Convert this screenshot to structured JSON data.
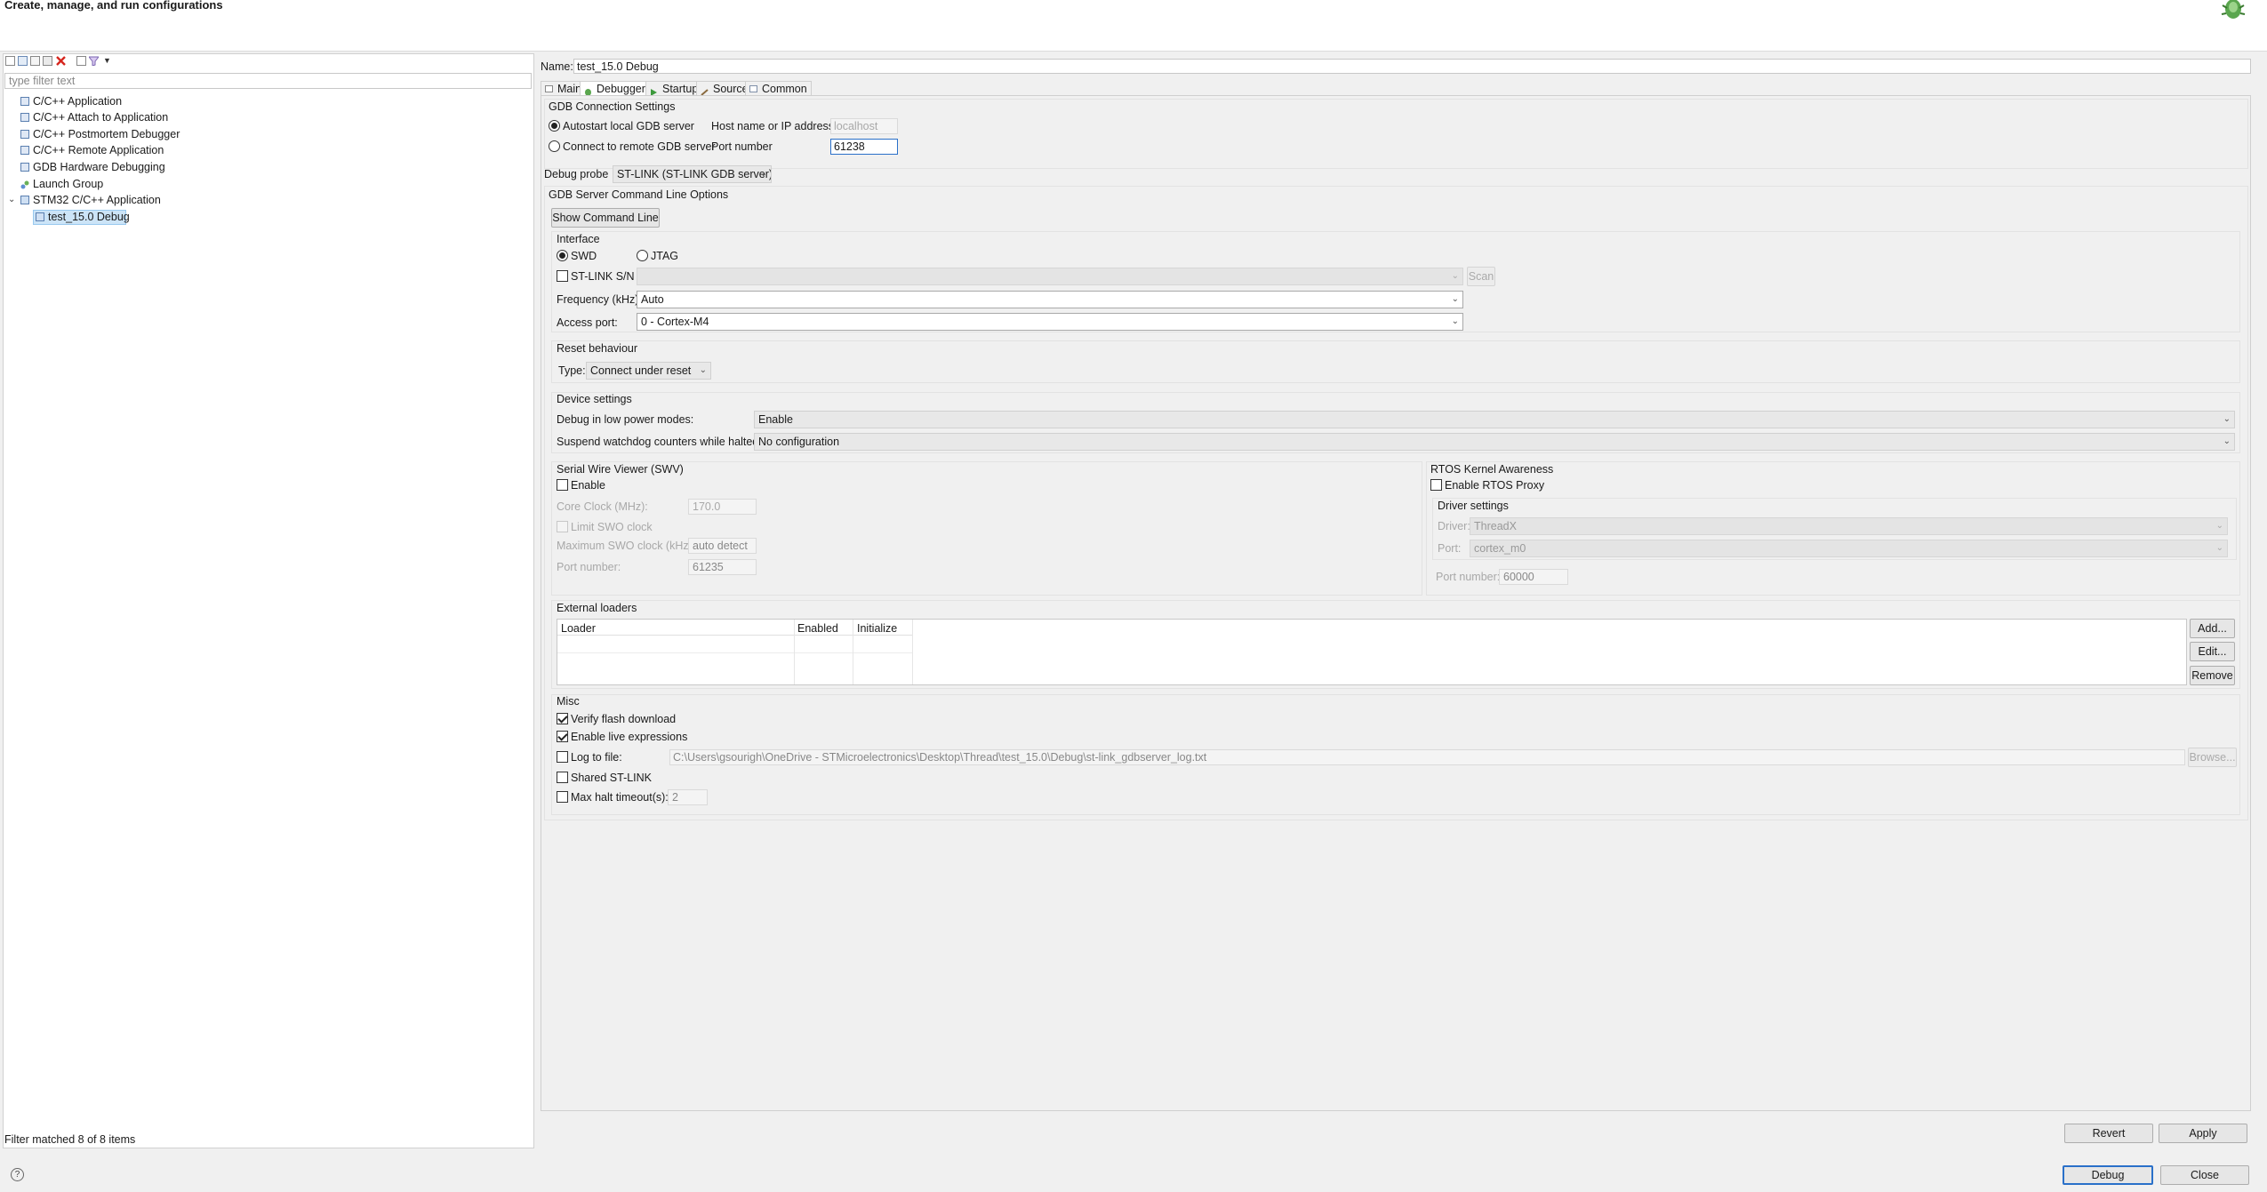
{
  "header": {
    "title": "Create, manage, and run configurations"
  },
  "left": {
    "filter_placeholder": "type filter text",
    "tree": [
      "C/C++ Application",
      "C/C++ Attach to Application",
      "C/C++ Postmortem Debugger",
      "C/C++ Remote Application",
      "GDB Hardware Debugging",
      "Launch Group",
      "STM32 C/C++ Application",
      "test_15.0 Debug"
    ],
    "status": "Filter matched 8 of 8 items"
  },
  "name": {
    "label": "Name:",
    "value": "test_15.0 Debug"
  },
  "tabs": [
    "Main",
    "Debugger",
    "Startup",
    "Source",
    "Common"
  ],
  "gdb": {
    "title": "GDB Connection Settings",
    "autostart": "Autostart local GDB server",
    "connect_remote": "Connect to remote GDB server",
    "host_label": "Host name or IP address",
    "host_value": "localhost",
    "port_label": "Port number",
    "port_value": "61238"
  },
  "probe": {
    "label": "Debug probe",
    "value": "ST-LINK (ST-LINK GDB server)"
  },
  "gdb_server": {
    "title": "GDB Server Command Line Options",
    "show_cmd": "Show Command Line"
  },
  "interface": {
    "title": "Interface",
    "swd": "SWD",
    "jtag": "JTAG",
    "stlink_sn": "ST-LINK S/N",
    "scan": "Scan",
    "freq_label": "Frequency (kHz):",
    "freq_value": "Auto",
    "access_label": "Access port:",
    "access_value": "0 - Cortex-M4"
  },
  "reset": {
    "title": "Reset behaviour",
    "type_label": "Type:",
    "type_value": "Connect under reset"
  },
  "device": {
    "title": "Device settings",
    "low_power_label": "Debug in low power modes:",
    "low_power_value": "Enable",
    "watchdog_label": "Suspend watchdog counters while halted:",
    "watchdog_value": "No configuration"
  },
  "swv": {
    "title": "Serial Wire Viewer (SWV)",
    "enable": "Enable",
    "core_clock_label": "Core Clock (MHz):",
    "core_clock_value": "170.0",
    "limit": "Limit SWO clock",
    "max_swo_label": "Maximum SWO clock (kHz):",
    "max_swo_value": "auto detect",
    "port_label": "Port number:",
    "port_value": "61235"
  },
  "rtos": {
    "title": "RTOS Kernel Awareness",
    "enable_proxy": "Enable RTOS Proxy",
    "driver_settings": "Driver settings",
    "driver_label": "Driver:",
    "driver_value": "ThreadX",
    "port_label": "Port:",
    "port_value": "cortex_m0",
    "port_number_label": "Port number:",
    "port_number_value": "60000"
  },
  "loaders": {
    "title": "External loaders",
    "columns": [
      "Loader",
      "Enabled",
      "Initialize"
    ],
    "add": "Add...",
    "edit": "Edit...",
    "remove": "Remove"
  },
  "misc": {
    "title": "Misc",
    "verify": "Verify flash download",
    "live": "Enable live expressions",
    "log": "Log to file:",
    "log_path": "C:\\Users\\gsourigh\\OneDrive - STMicroelectronics\\Desktop\\Thread\\test_15.0\\Debug\\st-link_gdbserver_log.txt",
    "browse": "Browse...",
    "shared": "Shared ST-LINK",
    "halt": "Max halt timeout(s):",
    "halt_value": "2"
  },
  "buttons": {
    "revert": "Revert",
    "apply": "Apply",
    "debug": "Debug",
    "close": "Close",
    "help": "?"
  }
}
